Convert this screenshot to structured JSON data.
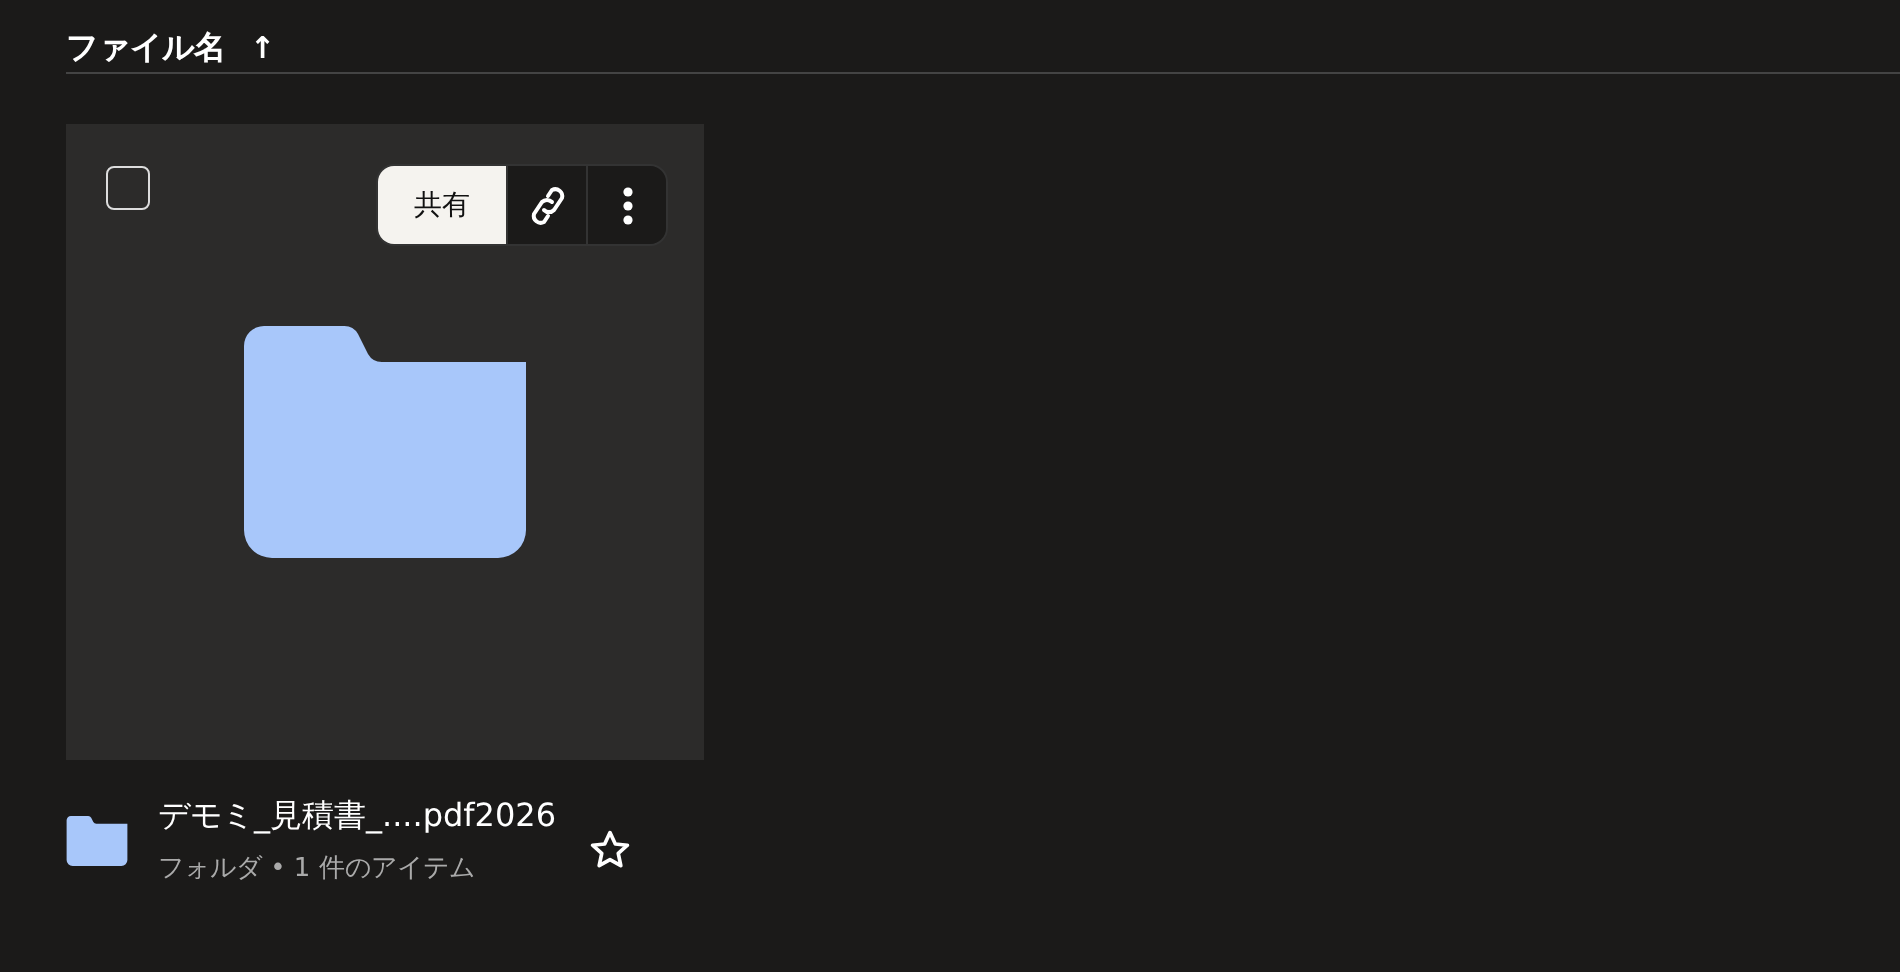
{
  "header": {
    "label": "ファイル名",
    "sort_icon": "↑"
  },
  "items": [
    {
      "kind": "folder",
      "name": "デモミ_見積書_....pdf2026",
      "meta": "フォルダ • 1 件のアイテム",
      "checked": false,
      "starred": false,
      "share_label": "共有"
    }
  ]
}
